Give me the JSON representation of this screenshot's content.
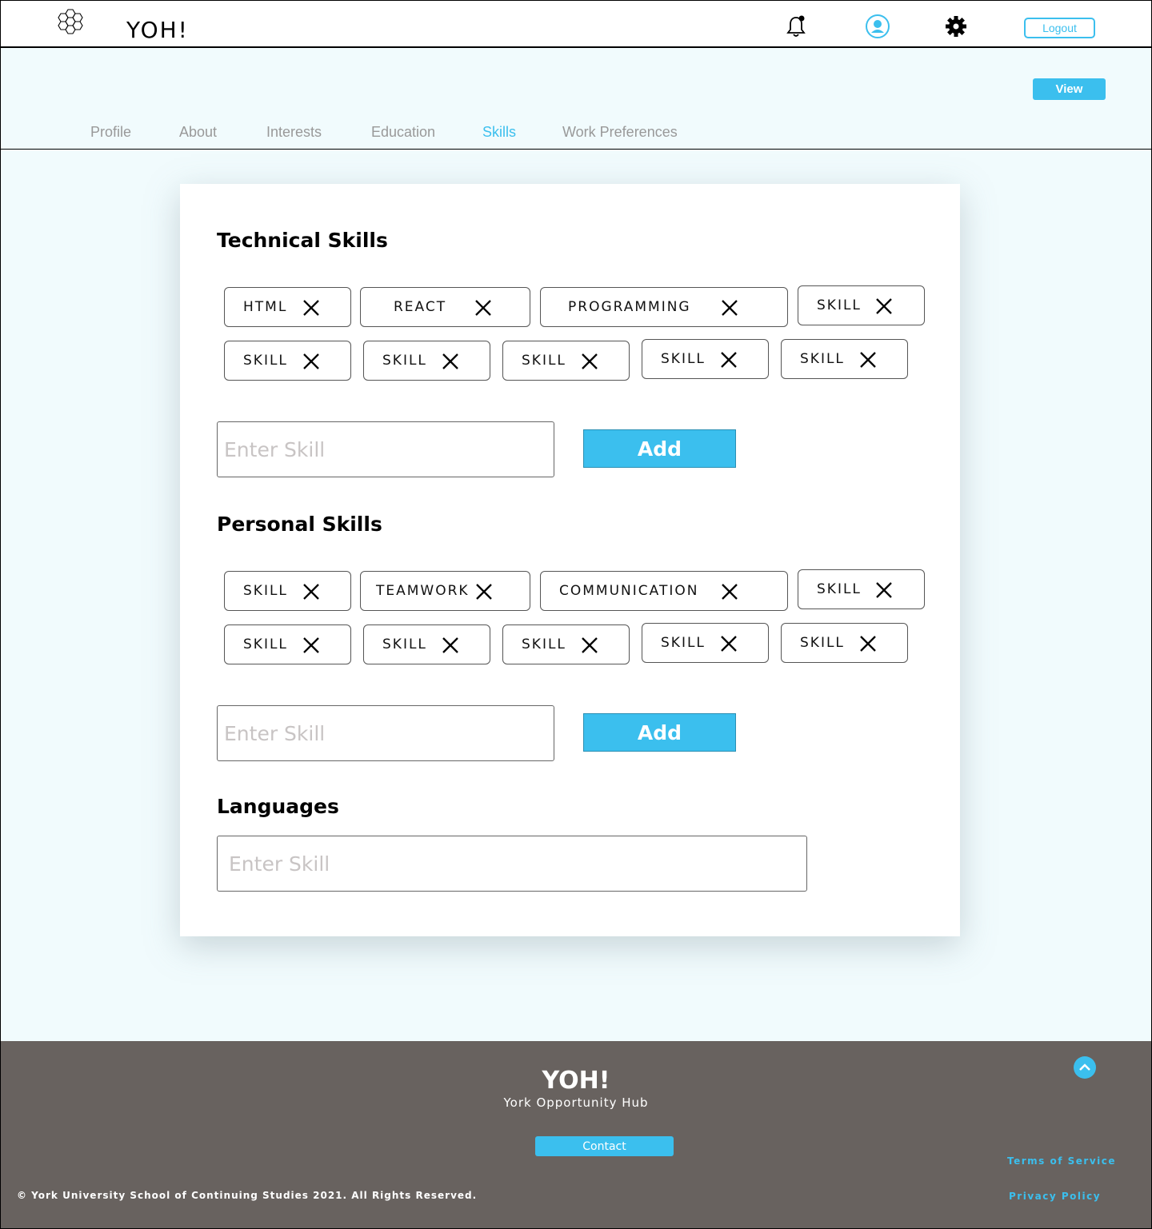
{
  "header": {
    "app_title": "YOH!",
    "logout_label": "Logout",
    "icons": [
      "hexagon-logo-icon",
      "bell-icon",
      "user-icon",
      "gear-icon"
    ],
    "accent_color": "#3bbfee"
  },
  "subnav": {
    "view_label": "View",
    "tabs": [
      {
        "label": "Profile"
      },
      {
        "label": "About"
      },
      {
        "label": "Interests"
      },
      {
        "label": "Education"
      },
      {
        "label": "Skills",
        "active": true
      },
      {
        "label": "Work Preferences"
      }
    ]
  },
  "technical": {
    "title": "Technical Skills",
    "chips": [
      "HTML",
      "REACT",
      "PROGRAMMING",
      "SKILL",
      "SKILL",
      "SKILL",
      "SKILL",
      "SKILL",
      "SKILL"
    ],
    "input_placeholder": "Enter Skill",
    "add_label": "Add"
  },
  "personal": {
    "title": "Personal Skills",
    "chips": [
      "SKILL",
      "TEAMWORK",
      "COMMUNICATION",
      "SKILL",
      "SKILL",
      "SKILL",
      "SKILL",
      "SKILL",
      "SKILL"
    ],
    "input_placeholder": "Enter Skill",
    "add_label": "Add"
  },
  "languages": {
    "title": "Languages",
    "input_placeholder": "Enter Skill"
  },
  "footer": {
    "title": "YOH!",
    "subtitle": "York Opportunity Hub",
    "contact_label": "Contact",
    "copyright": "© York University School of Continuing Studies 2021. All Rights Reserved.",
    "terms_label": "Terms of Service",
    "privacy_label": "Privacy Policy",
    "background_color": "#68625f"
  }
}
